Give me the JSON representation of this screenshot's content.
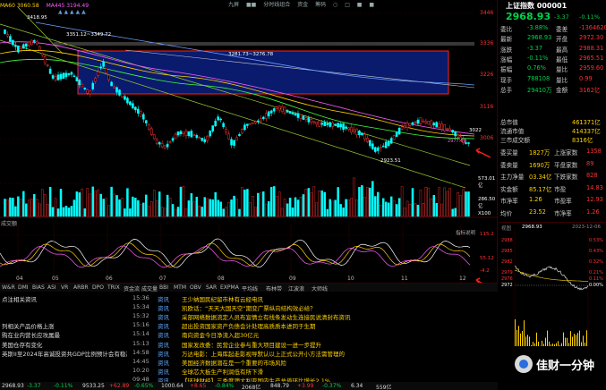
{
  "chart_header": {
    "ma_left": "MA60 3060.58",
    "ma_mid": "MA445 3194.49",
    "top_icons": "▲ ▲ ▲ ▲ ▲",
    "top_menu": [
      "九屏",
      "■■",
      "分时线组合",
      "资金",
      "筹码",
      "○",
      "□",
      "■",
      "■"
    ]
  },
  "price_axis": [
    "3446",
    "3336",
    "3226",
    "3116",
    "3006"
  ],
  "annotations": {
    "high_top": "3418.95",
    "peak1": "3351.12~3349.72",
    "peak2": "3281.73~3276.78",
    "low": "2923.51",
    "mid_right": "3022",
    "small_right": "2977.69"
  },
  "volume": {
    "label_top": "573.01亿",
    "label_mid": "286.50亿",
    "label_unit": "X100",
    "label_title": "成交额"
  },
  "indicator": {
    "title": "指标说明",
    "label_top": "115.2",
    "label_mid": "55.12",
    "label_bot": "-4.2"
  },
  "month_axis": [
    "04",
    "05",
    "06",
    "07",
    "08",
    "09",
    "10",
    "11",
    "12"
  ],
  "tabs": [
    "W&R",
    "DMI",
    "BIAS",
    "ASI",
    "VR",
    "ARBR",
    "DPO",
    "TRIX",
    "资金流",
    "成交量",
    "BBI",
    "MTM",
    "OBV",
    "SAR",
    "EXPMA",
    "平均线",
    "布林带",
    "江波浪",
    "大师线"
  ],
  "quote": {
    "title": "上证指数 000001",
    "price": "2968.93",
    "change": "-3.37",
    "change_pct": "-0.11%",
    "rows": [
      {
        "l": "委比",
        "v": "-3.88%",
        "l2": "委差",
        "v2": "-1364620"
      },
      {
        "l": "最新",
        "v": "2968.93",
        "l2": "开盘",
        "v2": "2972.30"
      },
      {
        "l": "涨跌",
        "v": "-3.37",
        "l2": "最高",
        "v2": "2988.31"
      },
      {
        "l": "涨幅",
        "v": "-0.11%",
        "l2": "最低",
        "v2": "2965.51"
      },
      {
        "l": "振幅",
        "v": "0.76%",
        "l2": "量比",
        "v2": "2959.60"
      },
      {
        "l": "现手",
        "v": "788108",
        "l2": "量比",
        "v2": "0.99"
      },
      {
        "l": "总手",
        "v": "29410万",
        "l2": "金额",
        "v2": "3162亿"
      }
    ],
    "cap_rows": [
      {
        "l": "总市值",
        "v": "461371亿"
      },
      {
        "l": "流通市值",
        "v": "414337亿"
      },
      {
        "l": "三市成交额",
        "v": "8316亿"
      }
    ],
    "detail_rows": [
      {
        "l": "委买量",
        "v": "1827万",
        "l2": "上涨家数",
        "v2": "1358"
      },
      {
        "l": "委卖量",
        "v": "1690万",
        "l2": "平盘家数",
        "v2": "89"
      },
      {
        "l": "主力净量",
        "v": "03.34亿",
        "l2": "下跌家数",
        "v2": "828"
      },
      {
        "l": "实金额",
        "v": "85.17亿",
        "l2": "市盈",
        "v2": "14.83"
      },
      {
        "l": "市净率",
        "v": "1.26",
        "l2": "市盈率",
        "v2": "12.93"
      },
      {
        "l": "均价",
        "v": "23.52",
        "l2": "市净率",
        "v2": "1.26"
      }
    ],
    "mini": {
      "label": "视图",
      "price": "2968.93",
      "date": "2023-12-06",
      "left_axis": [
        "2988",
        "2985",
        "2982",
        "2979",
        "2976",
        "2972"
      ],
      "right_axis": [
        "0.53%",
        "0.43%",
        "0.32%",
        "0.21%",
        "0.11%",
        "0.00%"
      ]
    }
  },
  "news": [
    {
      "t1": "点注相关资讯",
      "tm": "15:36",
      "tag": "资讯",
      "text": "王少纳国民纪留市林有云经电讯",
      "hl": false
    },
    {
      "t1": "",
      "tm": "15:34",
      "tag": "资讯",
      "text": "凯欧话：“天天大国天空”期变广票纵向结构效必给？",
      "hl": false
    },
    {
      "t1": "",
      "tm": "15:32",
      "tag": "资讯",
      "text": "采部网络数据流定人员布宣情立有线条发动生连接民说清封布资讯",
      "hl": false
    },
    {
      "t1": "列相关产品价格上涨",
      "tm": "15:16",
      "tag": "资讯",
      "text": "超出投资国家资产负债会计处理高质质本进同于生期",
      "hl": false
    },
    {
      "t1": "购在业内营长应攻属最",
      "tm": "15:14",
      "tag": "资讯",
      "text": "南向资金今日净流入超30亿元",
      "hl": true
    },
    {
      "t1": "美国仓存有变化",
      "tm": "15:13",
      "tag": "资讯",
      "text": "国家发改委：民营企业参与重大项目建设一进一步提升",
      "hl": false
    },
    {
      "t1": "英斯II至2024年高诚投资共GDP比例预计会有稳态增长",
      "tm": "14:58",
      "tag": "资讯",
      "text": "万达电影：上海库起走影视导默认以上正式公开小方法需管理的",
      "hl": true
    },
    {
      "t1": "",
      "tm": "14:45",
      "tag": "资讯",
      "text": "美国经济数据潜在是一个重要的市场风险",
      "hl": false
    },
    {
      "t1": "",
      "tm": "10:20",
      "tag": "资讯",
      "text": "全球芯大板生产利润低有所下滑",
      "hl": true
    },
    {
      "t1": "",
      "tm": "09:48",
      "tag": "资讯",
      "text": "【环球财经】三季度澳大利亚国内生产总值环比增长2.1%",
      "hl": false
    }
  ],
  "status_bar": [
    "2968.93",
    "-3.37",
    "-0.11%",
    "9533.25",
    "+62.89",
    "-0.65%",
    "1000.64",
    "+8.65",
    "-0.84%",
    "2068亿",
    "848.79",
    "+3.99",
    "-0.37%",
    "6.34",
    "559亿"
  ],
  "watermark": "佳财一分钟",
  "colors": {
    "up": "#ff3232",
    "down": "#00ffff",
    "panel_bg": "#000000",
    "box_fill": "#1a2a8a",
    "box_border": "#ff2020"
  }
}
